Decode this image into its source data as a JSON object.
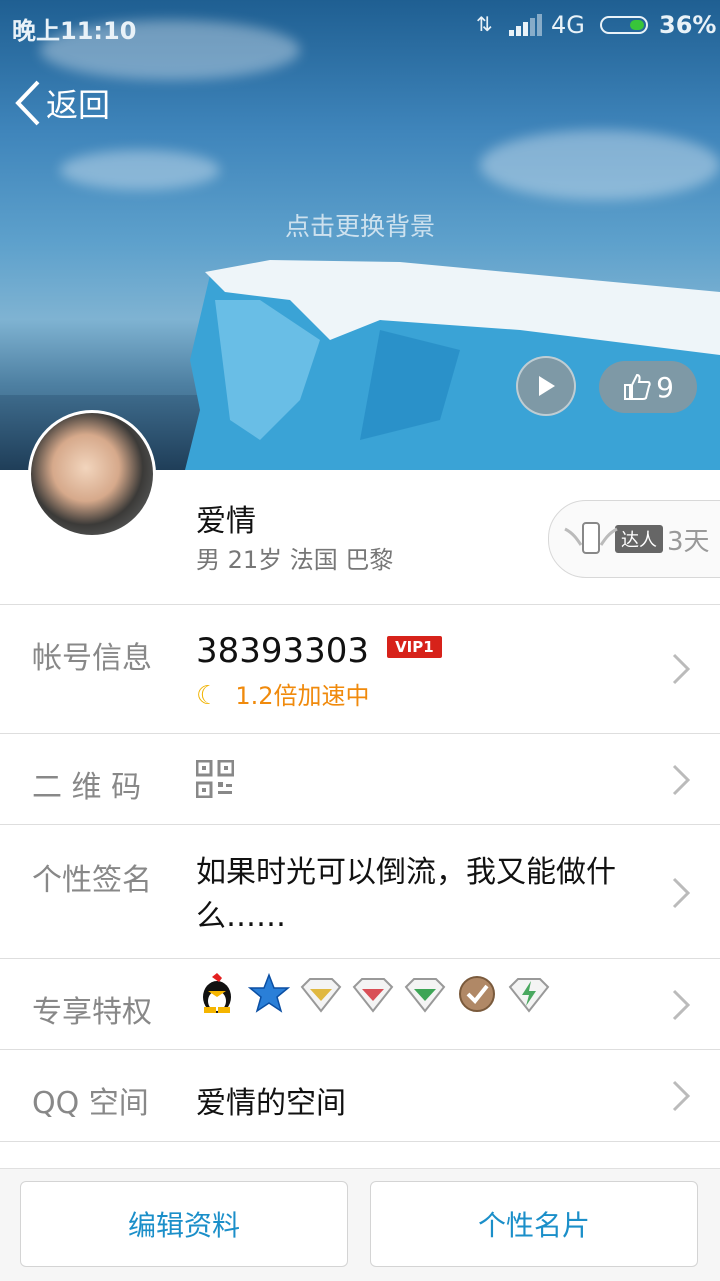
{
  "status": {
    "time": "晚上11:10",
    "network": "4G",
    "battery_pct": "36%",
    "battery_level": 0.36
  },
  "header": {
    "back_label": "返回",
    "change_bg": "点击更换背景",
    "like_count": "9"
  },
  "profile": {
    "name": "爱情",
    "details": "男 21岁 法国 巴黎",
    "expert_badge": "达人",
    "expert_days": "3天"
  },
  "rows": {
    "account": {
      "label": "帐号信息",
      "value": "38393303",
      "vip": "VIP1",
      "speed": "1.2倍加速中"
    },
    "qr": {
      "label": "二 维 码"
    },
    "signature": {
      "label": "个性签名",
      "value": "如果时光可以倒流，我又能做什么……"
    },
    "privileges": {
      "label": "专享特权",
      "icons": [
        "qq-penguin-icon",
        "blue-star-icon",
        "yellow-diamond-icon",
        "red-diamond-icon",
        "green-diamond-icon",
        "brown-check-icon",
        "lightning-diamond-icon"
      ]
    },
    "qzone": {
      "label": "QQ 空间",
      "value": "爱情的空间"
    }
  },
  "buttons": {
    "edit": "编辑资料",
    "card": "个性名片"
  },
  "colors": {
    "accent": "#1b8fc9",
    "vip": "#d7221a",
    "speed": "#f08a0c"
  }
}
